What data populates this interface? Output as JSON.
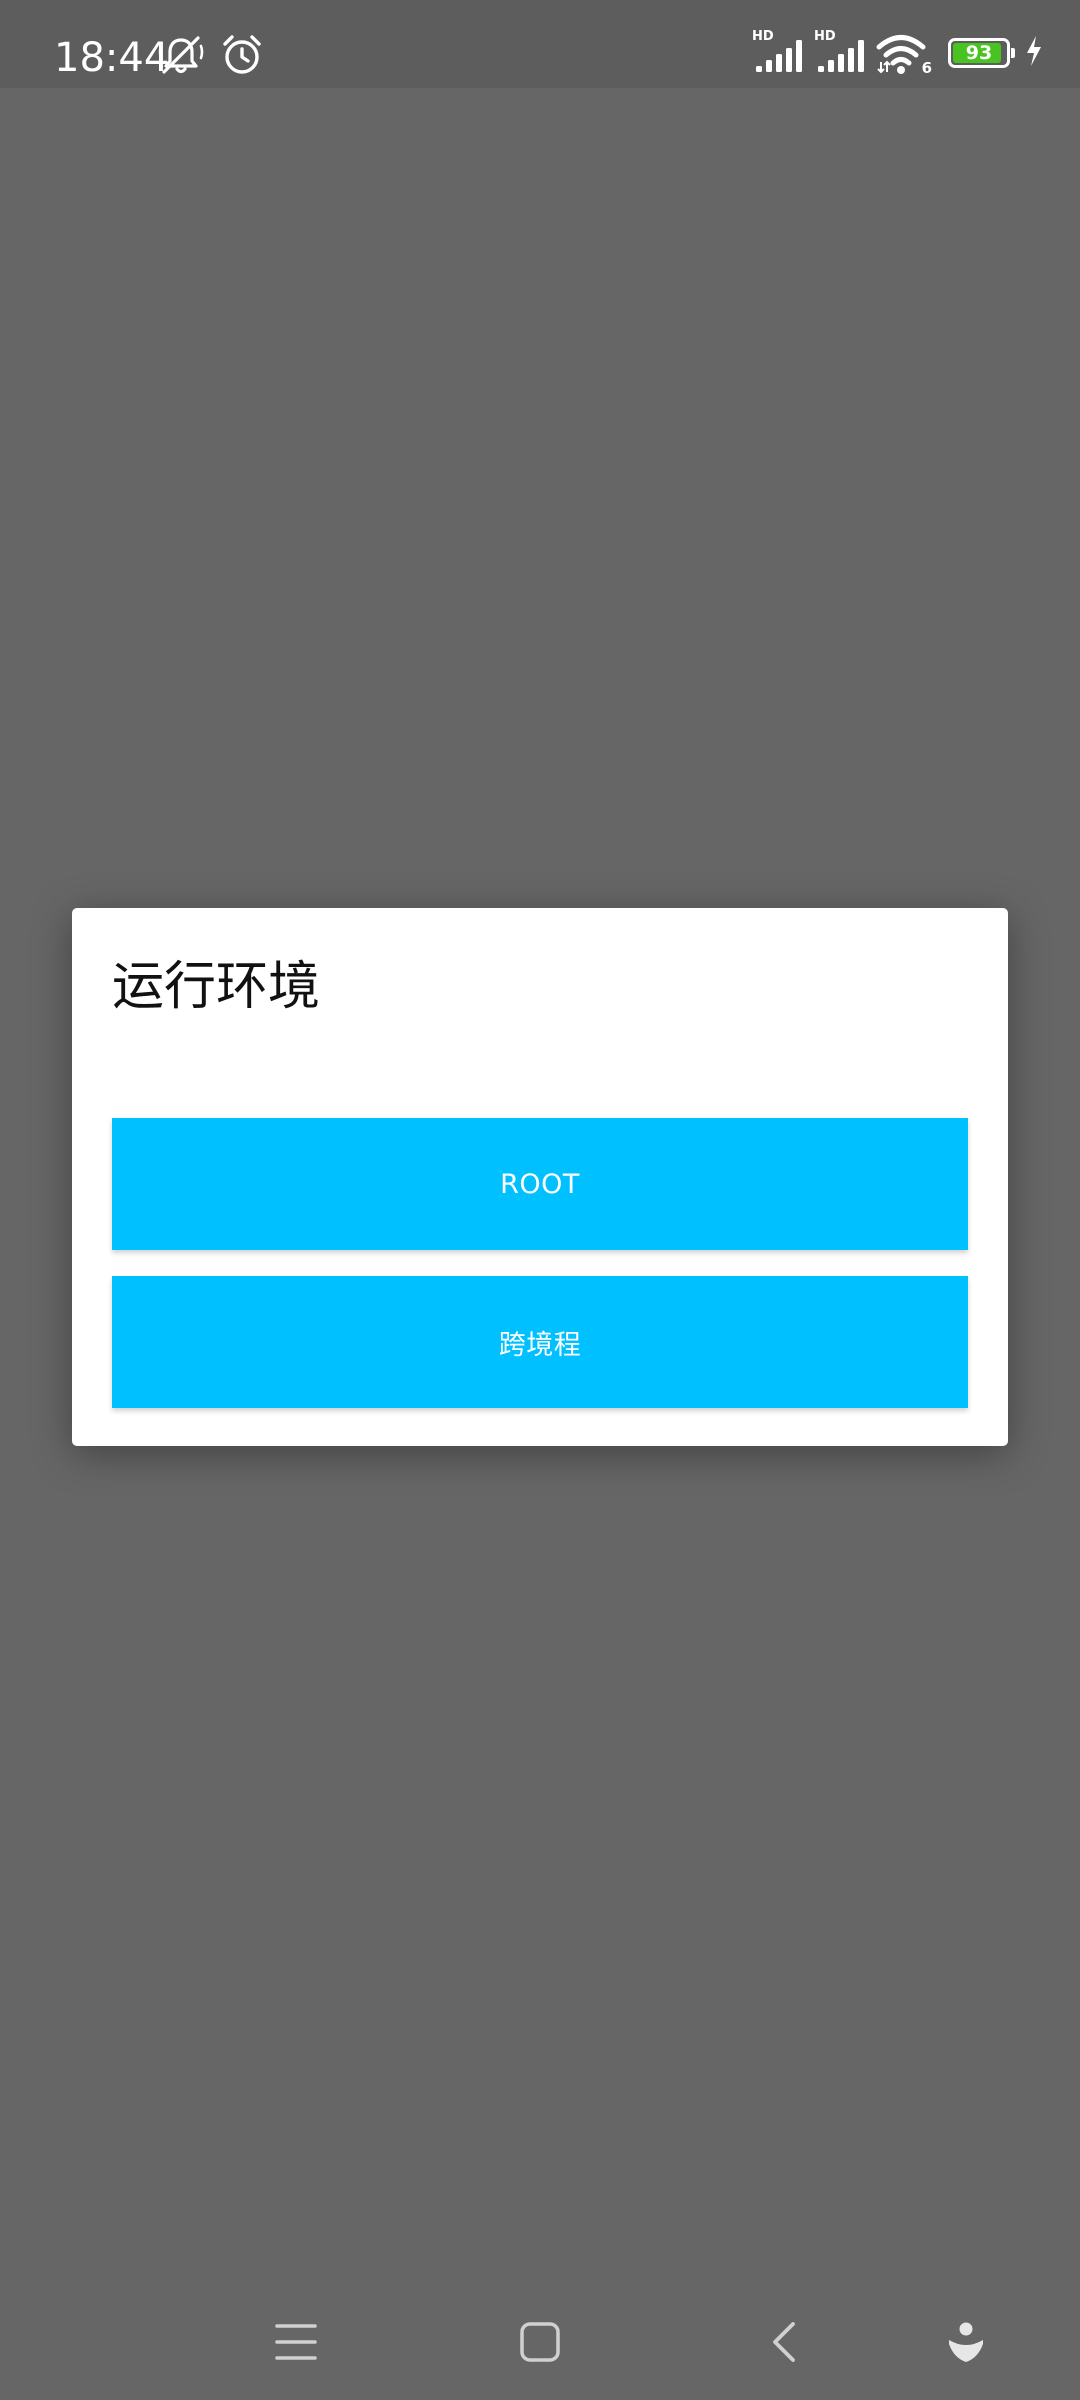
{
  "status_bar": {
    "time": "18:44",
    "signal_1_label": "HD",
    "signal_2_label": "HD",
    "wifi_label": "6",
    "battery_level": "93",
    "battery_fraction": 0.93,
    "icons": [
      "bell-muted-icon",
      "alarm-clock-icon",
      "signal-icon",
      "signal-icon",
      "wifi-icon",
      "battery-icon",
      "charging-icon"
    ]
  },
  "dialog": {
    "title": "运行环境",
    "buttons": [
      {
        "label": "ROOT"
      },
      {
        "label": "跨境程"
      }
    ]
  },
  "nav_bar": {
    "icons": [
      "menu-icon",
      "home-icon",
      "back-icon",
      "assistant-icon"
    ]
  },
  "colors": {
    "scrim": "#666666",
    "status_bar": "#5d5d5d",
    "button_accent": "#00c0ff",
    "battery_fill": "#48c322",
    "dialog_bg": "#ffffff"
  }
}
